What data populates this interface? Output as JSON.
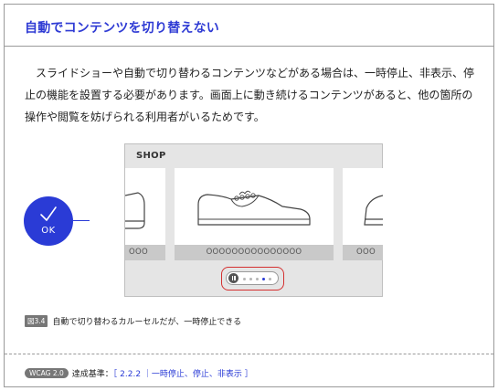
{
  "header": {
    "title": "自動でコンテンツを切り替えない"
  },
  "body": {
    "paragraph": "スライドショーや自動で切り替わるコンテンツなどがある場合は、一時停止、非表示、停止の機能を設置する必要があります。画面上に動き続けるコンテンツがあると、他の箇所の操作や閲覧を妨げられる利用者がいるためです。"
  },
  "badge": {
    "label": "OK",
    "icon": "checkmark-icon",
    "color": "#2a3bd6"
  },
  "figure": {
    "shop_label": "SHOP",
    "left_card_dots": "OOO",
    "main_card_dots": "OOOOOOOOOOOOOOO",
    "right_card_dots": "OOO",
    "controls": {
      "pause_icon": "pause-icon",
      "dot_count": 5,
      "active_dot": 3
    },
    "highlight_color": "#d43030"
  },
  "caption": {
    "fig_tag": "図3.4",
    "text": "自動で切り替わるカルーセルだが、一時停止できる"
  },
  "footer": {
    "wcag_tag": "WCAG 2.0",
    "label": "達成基準：",
    "criterion": "［ 2.2.2 ｜一時停止、停止、非表示 ］"
  }
}
